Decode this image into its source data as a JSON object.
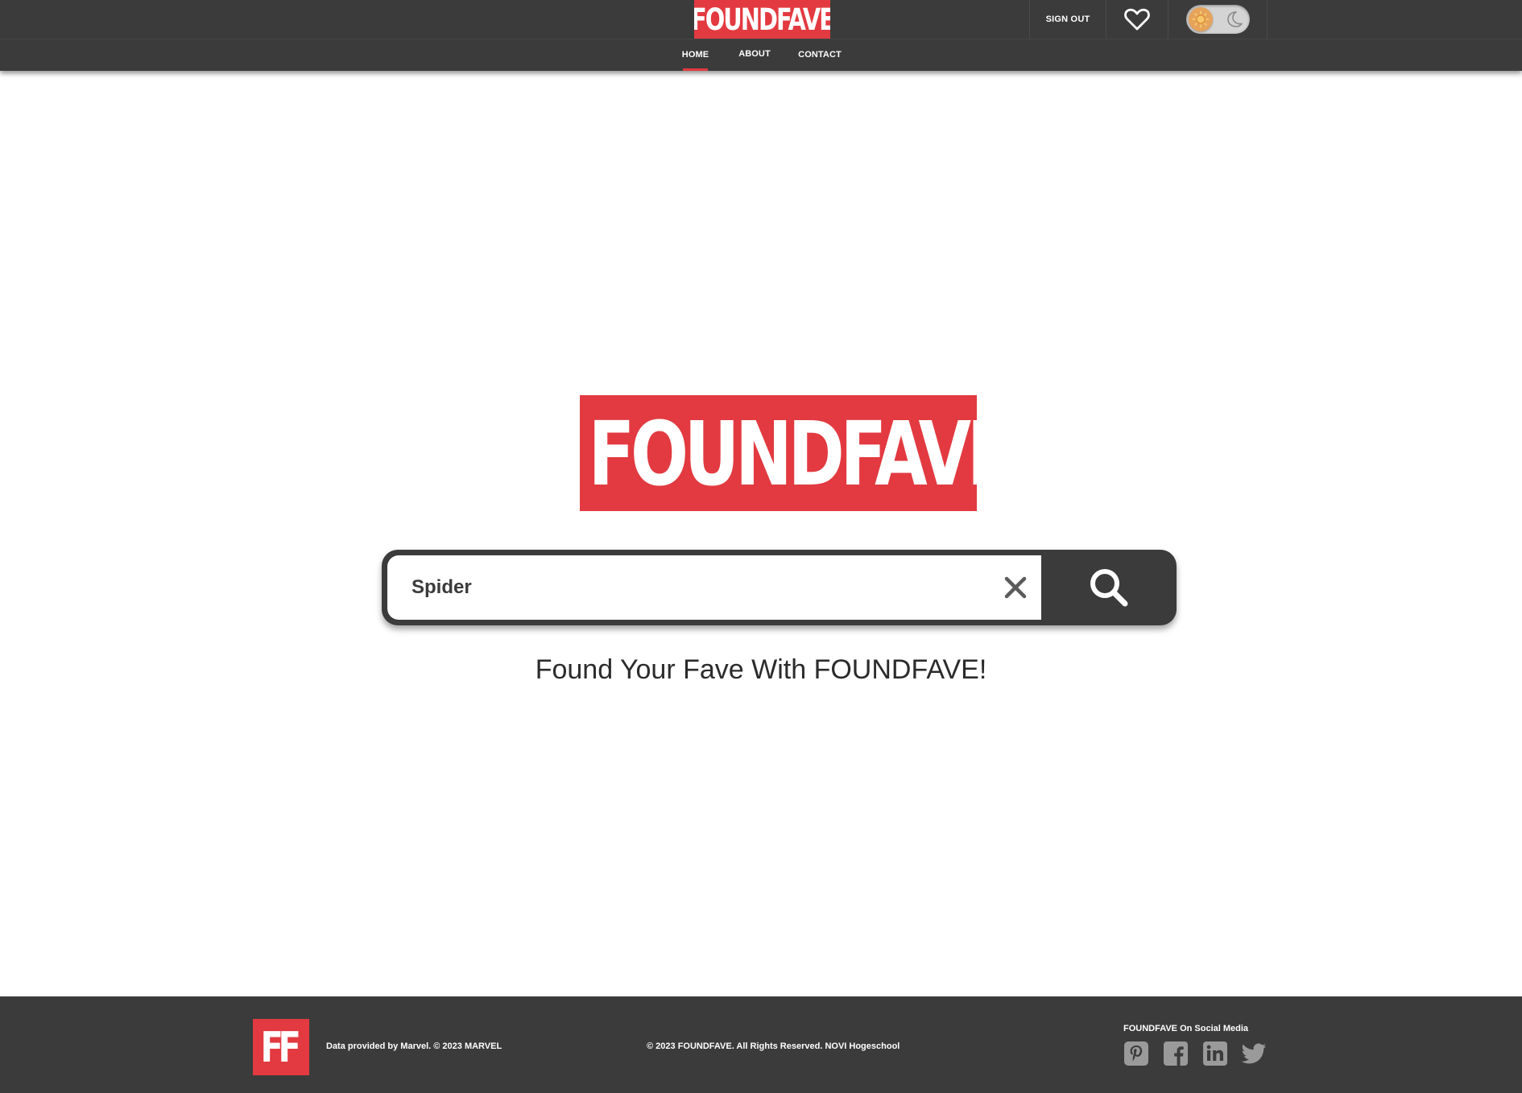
{
  "header": {
    "logo": "FOUNDFAVE",
    "sign_out_label": "SIGN OUT",
    "favorites_icon": "heart-icon",
    "theme_toggle": {
      "state": "light",
      "sun_icon": "sun-icon",
      "moon_icon": "moon-icon"
    }
  },
  "nav": {
    "items": [
      {
        "label": "HOME",
        "active": true
      },
      {
        "label": "ABOUT",
        "active": false
      },
      {
        "label": "CONTACT",
        "active": false
      }
    ]
  },
  "hero": {
    "logo": "FOUNDFAVE",
    "tagline": "Found Your Fave With FOUNDFAVE!"
  },
  "search": {
    "value": "Spider",
    "clear_icon": "close-icon",
    "submit_icon": "search-icon"
  },
  "footer": {
    "logo": "FF",
    "data_credit": "Data provided by Marvel. © 2023 MARVEL",
    "copyright": "© 2023 FOUNDFAVE. All Rights Reserved. NOVI Hogeschool",
    "social_title": "FOUNDFAVE On Social Media",
    "social_icons": [
      "pinterest-icon",
      "facebook-icon",
      "linkedin-icon",
      "twitter-icon"
    ]
  },
  "colors": {
    "brand_red": "#e23a40",
    "dark_gray": "#3b3b3b",
    "white": "#ffffff",
    "toggle_sun": "#e6a35b",
    "icon_gray": "#9a9a9a"
  }
}
